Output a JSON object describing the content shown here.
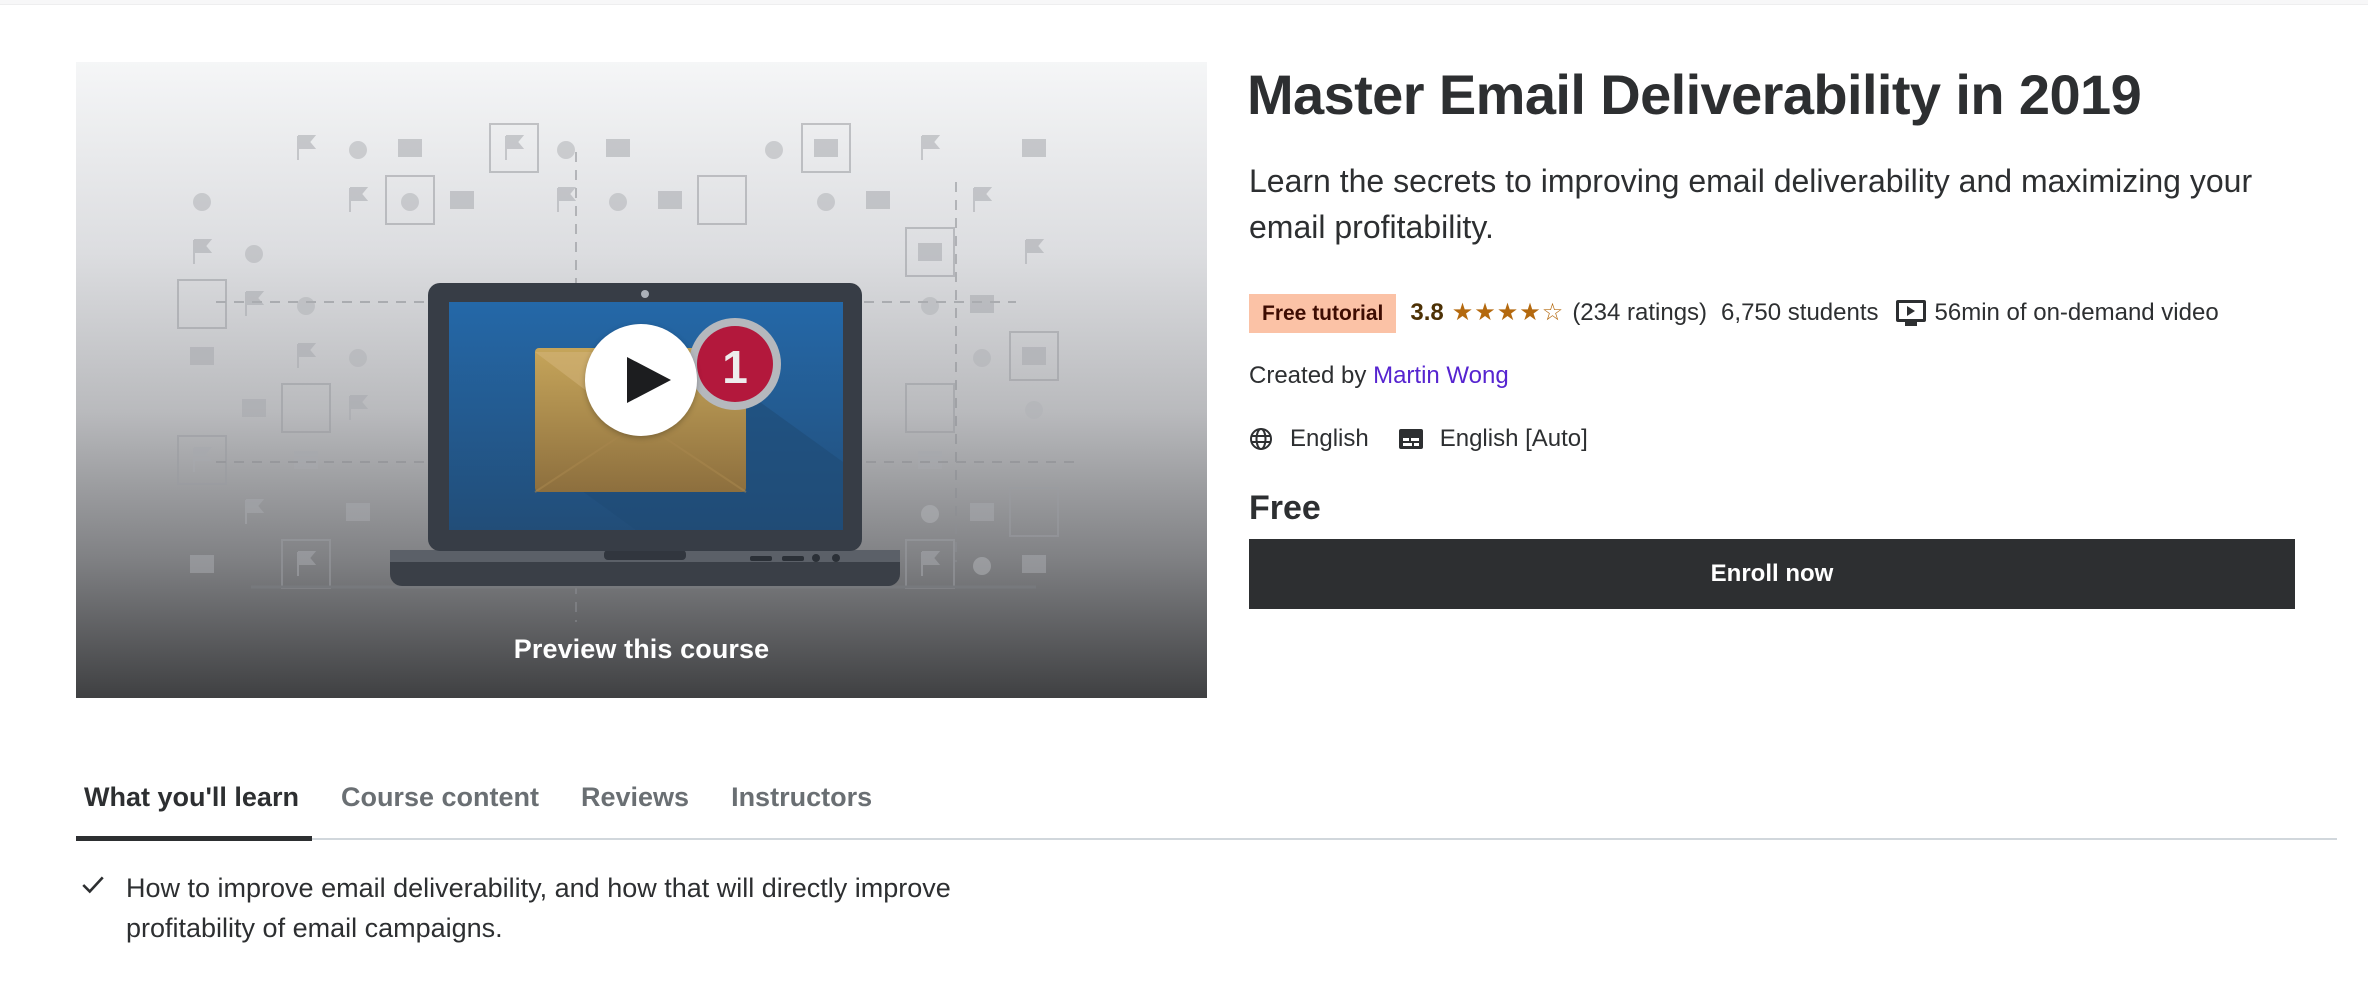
{
  "course": {
    "title": "Master Email Deliverability in 2019",
    "subtitle": "Learn the secrets to improving email deliverability and maximizing your email profitability.",
    "badge": "Free tutorial",
    "rating": "3.8",
    "rating_value": 3.8,
    "rating_max": 5,
    "stars": [
      "full",
      "full",
      "full",
      "full",
      "empty"
    ],
    "ratings_count": "(234 ratings)",
    "students": "6,750 students",
    "video_length": "56min of on-demand video",
    "created_by_label": "Created by",
    "instructor": "Martin Wong",
    "language": "English",
    "captions": "English [Auto]",
    "price": "Free",
    "enroll_label": "Enroll now"
  },
  "preview": {
    "label": "Preview this course",
    "notification_count": "1",
    "icons": [
      "play-icon",
      "envelope-icon",
      "notification-badge",
      "laptop-illustration"
    ]
  },
  "tabs": [
    {
      "label": "What you'll learn",
      "active": true
    },
    {
      "label": "Course content",
      "active": false
    },
    {
      "label": "Reviews",
      "active": false
    },
    {
      "label": "Instructors",
      "active": false
    }
  ],
  "learn_items": [
    "How to improve email deliverability, and how that will directly improve profitability of email campaigns."
  ],
  "colors": {
    "text": "#2d2f31",
    "badge_bg": "#fbc2a6",
    "badge_text": "#3d0c02",
    "rating_text": "#4d3105",
    "star": "#b4690e",
    "link": "#5624d0",
    "button_bg": "#2d2f31",
    "tab_inactive": "#6a6f73",
    "divider": "#d1d7dc"
  }
}
